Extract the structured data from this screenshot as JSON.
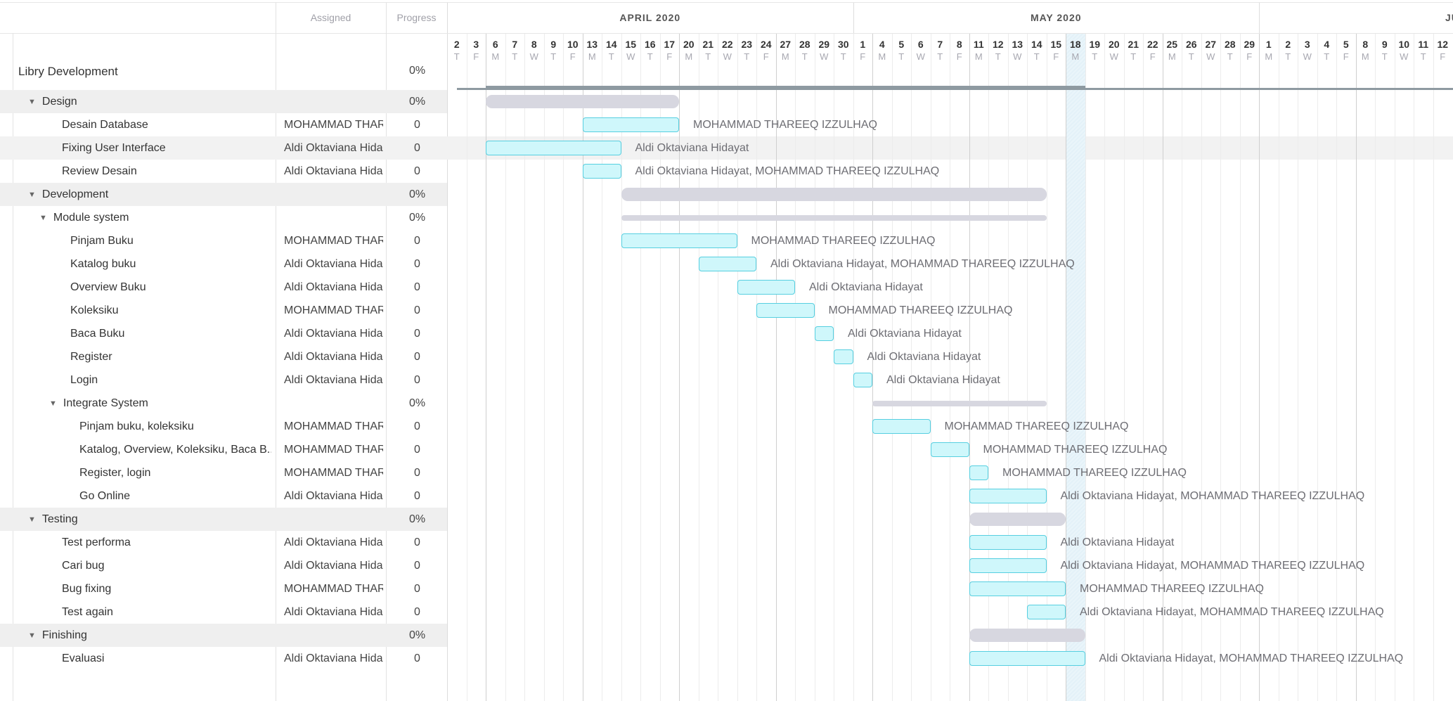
{
  "columns": {
    "name": "",
    "assigned": "Assigned",
    "progress": "Progress"
  },
  "project": {
    "name": "Libry Development",
    "progress": "0%"
  },
  "timeline": {
    "months": [
      {
        "label": "APRIL 2020",
        "start_index": 0,
        "end_index": 21
      },
      {
        "label": "MAY 2020",
        "start_index": 21,
        "end_index": 42
      },
      {
        "label": "JU",
        "start_index": 42,
        "end_index": 52
      }
    ],
    "days": [
      {
        "d": "2",
        "w": "T"
      },
      {
        "d": "3",
        "w": "F"
      },
      {
        "d": "6",
        "w": "M"
      },
      {
        "d": "7",
        "w": "T"
      },
      {
        "d": "8",
        "w": "W"
      },
      {
        "d": "9",
        "w": "T"
      },
      {
        "d": "10",
        "w": "F"
      },
      {
        "d": "13",
        "w": "M"
      },
      {
        "d": "14",
        "w": "T"
      },
      {
        "d": "15",
        "w": "W"
      },
      {
        "d": "16",
        "w": "T"
      },
      {
        "d": "17",
        "w": "F"
      },
      {
        "d": "20",
        "w": "M"
      },
      {
        "d": "21",
        "w": "T"
      },
      {
        "d": "22",
        "w": "W"
      },
      {
        "d": "23",
        "w": "T"
      },
      {
        "d": "24",
        "w": "F"
      },
      {
        "d": "27",
        "w": "M"
      },
      {
        "d": "28",
        "w": "T"
      },
      {
        "d": "29",
        "w": "W"
      },
      {
        "d": "30",
        "w": "T"
      },
      {
        "d": "1",
        "w": "F"
      },
      {
        "d": "4",
        "w": "M"
      },
      {
        "d": "5",
        "w": "T"
      },
      {
        "d": "6",
        "w": "W"
      },
      {
        "d": "7",
        "w": "T"
      },
      {
        "d": "8",
        "w": "F"
      },
      {
        "d": "11",
        "w": "M"
      },
      {
        "d": "12",
        "w": "T"
      },
      {
        "d": "13",
        "w": "W"
      },
      {
        "d": "14",
        "w": "T"
      },
      {
        "d": "15",
        "w": "F"
      },
      {
        "d": "18",
        "w": "M"
      },
      {
        "d": "19",
        "w": "T"
      },
      {
        "d": "20",
        "w": "W"
      },
      {
        "d": "21",
        "w": "T"
      },
      {
        "d": "22",
        "w": "F"
      },
      {
        "d": "25",
        "w": "M"
      },
      {
        "d": "26",
        "w": "T"
      },
      {
        "d": "27",
        "w": "W"
      },
      {
        "d": "28",
        "w": "T"
      },
      {
        "d": "29",
        "w": "F"
      },
      {
        "d": "1",
        "w": "M"
      },
      {
        "d": "2",
        "w": "T"
      },
      {
        "d": "3",
        "w": "W"
      },
      {
        "d": "4",
        "w": "T"
      },
      {
        "d": "5",
        "w": "F"
      },
      {
        "d": "8",
        "w": "M"
      },
      {
        "d": "9",
        "w": "T"
      },
      {
        "d": "10",
        "w": "W"
      },
      {
        "d": "11",
        "w": "T"
      },
      {
        "d": "12",
        "w": "F"
      }
    ],
    "today_index": 32,
    "project_span": {
      "start": 2,
      "end": 33
    }
  },
  "rows": [
    {
      "name": "Design",
      "type": "group",
      "level": 1,
      "assigned": "",
      "progress": "0%",
      "start": 2,
      "end": 12
    },
    {
      "name": "Desain Database",
      "type": "task",
      "level": 2,
      "assigned": "MOHAMMAD THAR",
      "progress": "0",
      "start": 7,
      "end": 12,
      "bar_label": "MOHAMMAD THAREEQ IZZULHAQ"
    },
    {
      "name": "Fixing User Interface",
      "type": "task",
      "level": 2,
      "assigned": "Aldi Oktaviana Hida",
      "progress": "0",
      "start": 2,
      "end": 9,
      "bar_label": "Aldi Oktaviana Hidayat",
      "hover": true
    },
    {
      "name": "Review Desain",
      "type": "task",
      "level": 2,
      "assigned": "Aldi Oktaviana Hida",
      "progress": "0",
      "start": 7,
      "end": 9,
      "bar_label": "Aldi Oktaviana Hidayat, MOHAMMAD THAREEQ IZZULHAQ"
    },
    {
      "name": "Development",
      "type": "group",
      "level": 1,
      "assigned": "",
      "progress": "0%",
      "start": 9,
      "end": 31
    },
    {
      "name": "Module system",
      "type": "subgroup",
      "level": 2,
      "assigned": "",
      "progress": "0%",
      "start": 9,
      "end": 31
    },
    {
      "name": "Pinjam Buku",
      "type": "task",
      "level": 3,
      "assigned": "MOHAMMAD THAR",
      "progress": "0",
      "start": 9,
      "end": 15,
      "bar_label": "MOHAMMAD THAREEQ IZZULHAQ"
    },
    {
      "name": "Katalog buku",
      "type": "task",
      "level": 3,
      "assigned": "Aldi Oktaviana Hida",
      "progress": "0",
      "start": 13,
      "end": 16,
      "bar_label": "Aldi Oktaviana Hidayat, MOHAMMAD THAREEQ IZZULHAQ"
    },
    {
      "name": "Overview Buku",
      "type": "task",
      "level": 3,
      "assigned": "Aldi Oktaviana Hida",
      "progress": "0",
      "start": 15,
      "end": 18,
      "bar_label": "Aldi Oktaviana Hidayat"
    },
    {
      "name": "Koleksiku",
      "type": "task",
      "level": 3,
      "assigned": "MOHAMMAD THAR",
      "progress": "0",
      "start": 16,
      "end": 19,
      "bar_label": "MOHAMMAD THAREEQ IZZULHAQ"
    },
    {
      "name": "Baca Buku",
      "type": "task",
      "level": 3,
      "assigned": "Aldi Oktaviana Hida",
      "progress": "0",
      "start": 19,
      "end": 20,
      "bar_label": "Aldi Oktaviana Hidayat"
    },
    {
      "name": "Register",
      "type": "task",
      "level": 3,
      "assigned": "Aldi Oktaviana Hida",
      "progress": "0",
      "start": 20,
      "end": 21,
      "bar_label": "Aldi Oktaviana Hidayat"
    },
    {
      "name": "Login",
      "type": "task",
      "level": 3,
      "assigned": "Aldi Oktaviana Hida",
      "progress": "0",
      "start": 21,
      "end": 22,
      "bar_label": "Aldi Oktaviana Hidayat"
    },
    {
      "name": "Integrate System",
      "type": "subgroup",
      "level": 2.5,
      "assigned": "",
      "progress": "0%",
      "start": 22,
      "end": 31
    },
    {
      "name": "Pinjam buku, koleksiku",
      "type": "task",
      "level": 4,
      "assigned": "MOHAMMAD THAR",
      "progress": "0",
      "start": 22,
      "end": 25,
      "bar_label": "MOHAMMAD THAREEQ IZZULHAQ"
    },
    {
      "name": "Katalog, Overview, Koleksiku, Baca B...",
      "type": "task",
      "level": 4,
      "assigned": "MOHAMMAD THAR",
      "progress": "0",
      "start": 25,
      "end": 27,
      "bar_label": "MOHAMMAD THAREEQ IZZULHAQ"
    },
    {
      "name": "Register, login",
      "type": "task",
      "level": 4,
      "assigned": "MOHAMMAD THAR",
      "progress": "0",
      "start": 27,
      "end": 28,
      "bar_label": "MOHAMMAD THAREEQ IZZULHAQ"
    },
    {
      "name": "Go Online",
      "type": "task",
      "level": 4,
      "assigned": "Aldi Oktaviana Hida",
      "progress": "0",
      "start": 27,
      "end": 31,
      "bar_label": "Aldi Oktaviana Hidayat, MOHAMMAD THAREEQ IZZULHAQ"
    },
    {
      "name": "Testing",
      "type": "group",
      "level": 1,
      "assigned": "",
      "progress": "0%",
      "start": 27,
      "end": 32
    },
    {
      "name": "Test performa",
      "type": "task",
      "level": 2,
      "assigned": "Aldi Oktaviana Hida",
      "progress": "0",
      "start": 27,
      "end": 31,
      "bar_label": "Aldi Oktaviana Hidayat"
    },
    {
      "name": "Cari bug",
      "type": "task",
      "level": 2,
      "assigned": "Aldi Oktaviana Hida",
      "progress": "0",
      "start": 27,
      "end": 31,
      "bar_label": "Aldi Oktaviana Hidayat, MOHAMMAD THAREEQ IZZULHAQ"
    },
    {
      "name": "Bug fixing",
      "type": "task",
      "level": 2,
      "assigned": "MOHAMMAD THAR",
      "progress": "0",
      "start": 27,
      "end": 32,
      "bar_label": "MOHAMMAD THAREEQ IZZULHAQ"
    },
    {
      "name": "Test again",
      "type": "task",
      "level": 2,
      "assigned": "Aldi Oktaviana Hida",
      "progress": "0",
      "start": 30,
      "end": 32,
      "bar_label": "Aldi Oktaviana Hidayat, MOHAMMAD THAREEQ IZZULHAQ"
    },
    {
      "name": "Finishing",
      "type": "group",
      "level": 1,
      "assigned": "",
      "progress": "0%",
      "start": 27,
      "end": 33
    },
    {
      "name": "Evaluasi",
      "type": "task",
      "level": 2,
      "assigned": "Aldi Oktaviana Hida",
      "progress": "0",
      "start": 27,
      "end": 33,
      "bar_label": "Aldi Oktaviana Hidayat, MOHAMMAD THAREEQ IZZULHAQ"
    }
  ],
  "icons": {
    "collapse": "caret-down-icon"
  }
}
